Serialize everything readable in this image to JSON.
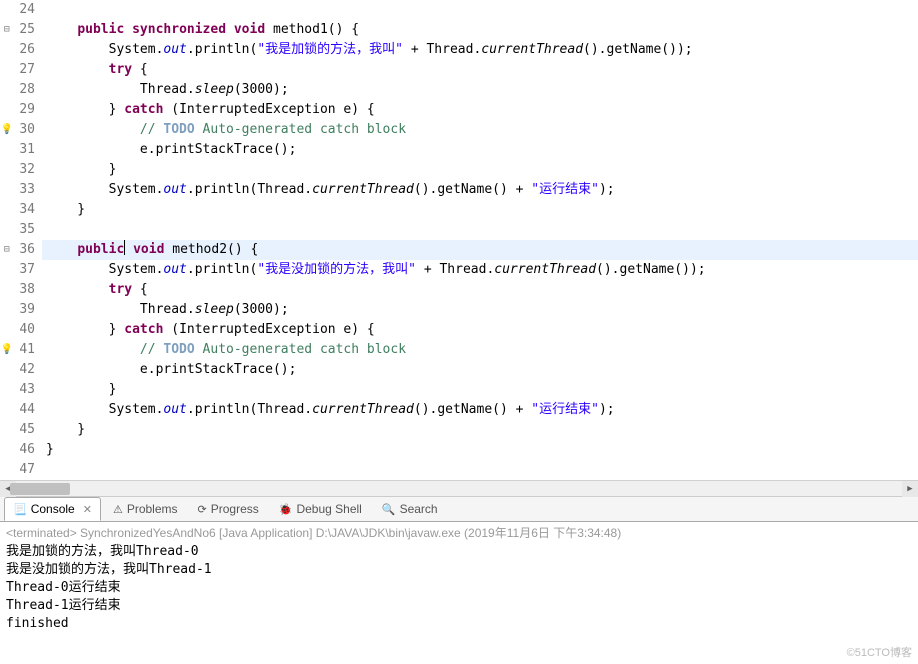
{
  "lines": [
    {
      "n": "24",
      "marker": "",
      "content": [
        {
          "t": "    "
        }
      ]
    },
    {
      "n": "25",
      "marker": "⊟",
      "content": [
        {
          "t": "    "
        },
        {
          "cls": "kw",
          "t": "public"
        },
        {
          "t": " "
        },
        {
          "cls": "kw",
          "t": "synchronized"
        },
        {
          "t": " "
        },
        {
          "cls": "kw",
          "t": "void"
        },
        {
          "t": " method1() {"
        }
      ]
    },
    {
      "n": "26",
      "marker": "",
      "content": [
        {
          "t": "        System."
        },
        {
          "cls": "field",
          "t": "out"
        },
        {
          "t": ".println("
        },
        {
          "cls": "str",
          "t": "\"我是加锁的方法，我叫\""
        },
        {
          "t": " + Thread."
        },
        {
          "cls": "method-static",
          "t": "currentThread"
        },
        {
          "t": "().getName());"
        }
      ]
    },
    {
      "n": "27",
      "marker": "",
      "content": [
        {
          "t": "        "
        },
        {
          "cls": "kw",
          "t": "try"
        },
        {
          "t": " {"
        }
      ]
    },
    {
      "n": "28",
      "marker": "",
      "content": [
        {
          "t": "            Thread."
        },
        {
          "cls": "method-static",
          "t": "sleep"
        },
        {
          "t": "(3000);"
        }
      ]
    },
    {
      "n": "29",
      "marker": "",
      "content": [
        {
          "t": "        } "
        },
        {
          "cls": "kw",
          "t": "catch"
        },
        {
          "t": " (InterruptedException e) {"
        }
      ]
    },
    {
      "n": "30",
      "marker": "💡",
      "content": [
        {
          "t": "            "
        },
        {
          "cls": "comment",
          "t": "// "
        },
        {
          "cls": "task",
          "t": "TODO"
        },
        {
          "cls": "comment",
          "t": " Auto-generated catch block"
        }
      ]
    },
    {
      "n": "31",
      "marker": "",
      "content": [
        {
          "t": "            e.printStackTrace();"
        }
      ]
    },
    {
      "n": "32",
      "marker": "",
      "content": [
        {
          "t": "        }"
        }
      ]
    },
    {
      "n": "33",
      "marker": "",
      "content": [
        {
          "t": "        System."
        },
        {
          "cls": "field",
          "t": "out"
        },
        {
          "t": ".println(Thread."
        },
        {
          "cls": "method-static",
          "t": "currentThread"
        },
        {
          "t": "().getName() + "
        },
        {
          "cls": "str",
          "t": "\"运行结束\""
        },
        {
          "t": ");"
        }
      ]
    },
    {
      "n": "34",
      "marker": "",
      "content": [
        {
          "t": "    }"
        }
      ]
    },
    {
      "n": "35",
      "marker": "",
      "content": [
        {
          "t": "    "
        }
      ]
    },
    {
      "n": "36",
      "marker": "⊟",
      "hl": true,
      "cursor_after_idx": 0,
      "content": [
        {
          "t": "    "
        },
        {
          "cls": "kw",
          "t": "public"
        },
        {
          "t": " "
        },
        {
          "cls": "kw",
          "t": "void"
        },
        {
          "t": " method2() {"
        }
      ]
    },
    {
      "n": "37",
      "marker": "",
      "content": [
        {
          "t": "        System."
        },
        {
          "cls": "field",
          "t": "out"
        },
        {
          "t": ".println("
        },
        {
          "cls": "str",
          "t": "\"我是没加锁的方法，我叫\""
        },
        {
          "t": " + Thread."
        },
        {
          "cls": "method-static",
          "t": "currentThread"
        },
        {
          "t": "().getName());"
        }
      ]
    },
    {
      "n": "38",
      "marker": "",
      "content": [
        {
          "t": "        "
        },
        {
          "cls": "kw",
          "t": "try"
        },
        {
          "t": " {"
        }
      ]
    },
    {
      "n": "39",
      "marker": "",
      "content": [
        {
          "t": "            Thread."
        },
        {
          "cls": "method-static",
          "t": "sleep"
        },
        {
          "t": "(3000);"
        }
      ]
    },
    {
      "n": "40",
      "marker": "",
      "content": [
        {
          "t": "        } "
        },
        {
          "cls": "kw",
          "t": "catch"
        },
        {
          "t": " (InterruptedException e) {"
        }
      ]
    },
    {
      "n": "41",
      "marker": "💡",
      "content": [
        {
          "t": "            "
        },
        {
          "cls": "comment",
          "t": "// "
        },
        {
          "cls": "task",
          "t": "TODO"
        },
        {
          "cls": "comment",
          "t": " Auto-generated catch block"
        }
      ]
    },
    {
      "n": "42",
      "marker": "",
      "content": [
        {
          "t": "            e.printStackTrace();"
        }
      ]
    },
    {
      "n": "43",
      "marker": "",
      "content": [
        {
          "t": "        }"
        }
      ]
    },
    {
      "n": "44",
      "marker": "",
      "content": [
        {
          "t": "        System."
        },
        {
          "cls": "field",
          "t": "out"
        },
        {
          "t": ".println(Thread."
        },
        {
          "cls": "method-static",
          "t": "currentThread"
        },
        {
          "t": "().getName() + "
        },
        {
          "cls": "str",
          "t": "\"运行结束\""
        },
        {
          "t": ");"
        }
      ]
    },
    {
      "n": "45",
      "marker": "",
      "content": [
        {
          "t": "    }"
        }
      ]
    },
    {
      "n": "46",
      "marker": "",
      "content": [
        {
          "t": "}"
        }
      ]
    },
    {
      "n": "47",
      "marker": "",
      "content": [
        {
          "t": ""
        }
      ]
    }
  ],
  "tabs": [
    {
      "label": "Console",
      "icon": "📃",
      "active": true
    },
    {
      "label": "Problems",
      "icon": "⚠",
      "active": false
    },
    {
      "label": "Progress",
      "icon": "⟳",
      "active": false
    },
    {
      "label": "Debug Shell",
      "icon": "🐞",
      "active": false
    },
    {
      "label": "Search",
      "icon": "🔍",
      "active": false
    }
  ],
  "console": {
    "header": "<terminated> SynchronizedYesAndNo6 [Java Application] D:\\JAVA\\JDK\\bin\\javaw.exe (2019年11月6日 下午3:34:48)",
    "lines": [
      "我是加锁的方法，我叫Thread-0",
      "我是没加锁的方法，我叫Thread-1",
      "Thread-0运行结束",
      "Thread-1运行结束",
      "finished"
    ]
  },
  "watermark": "©51CTO博客"
}
